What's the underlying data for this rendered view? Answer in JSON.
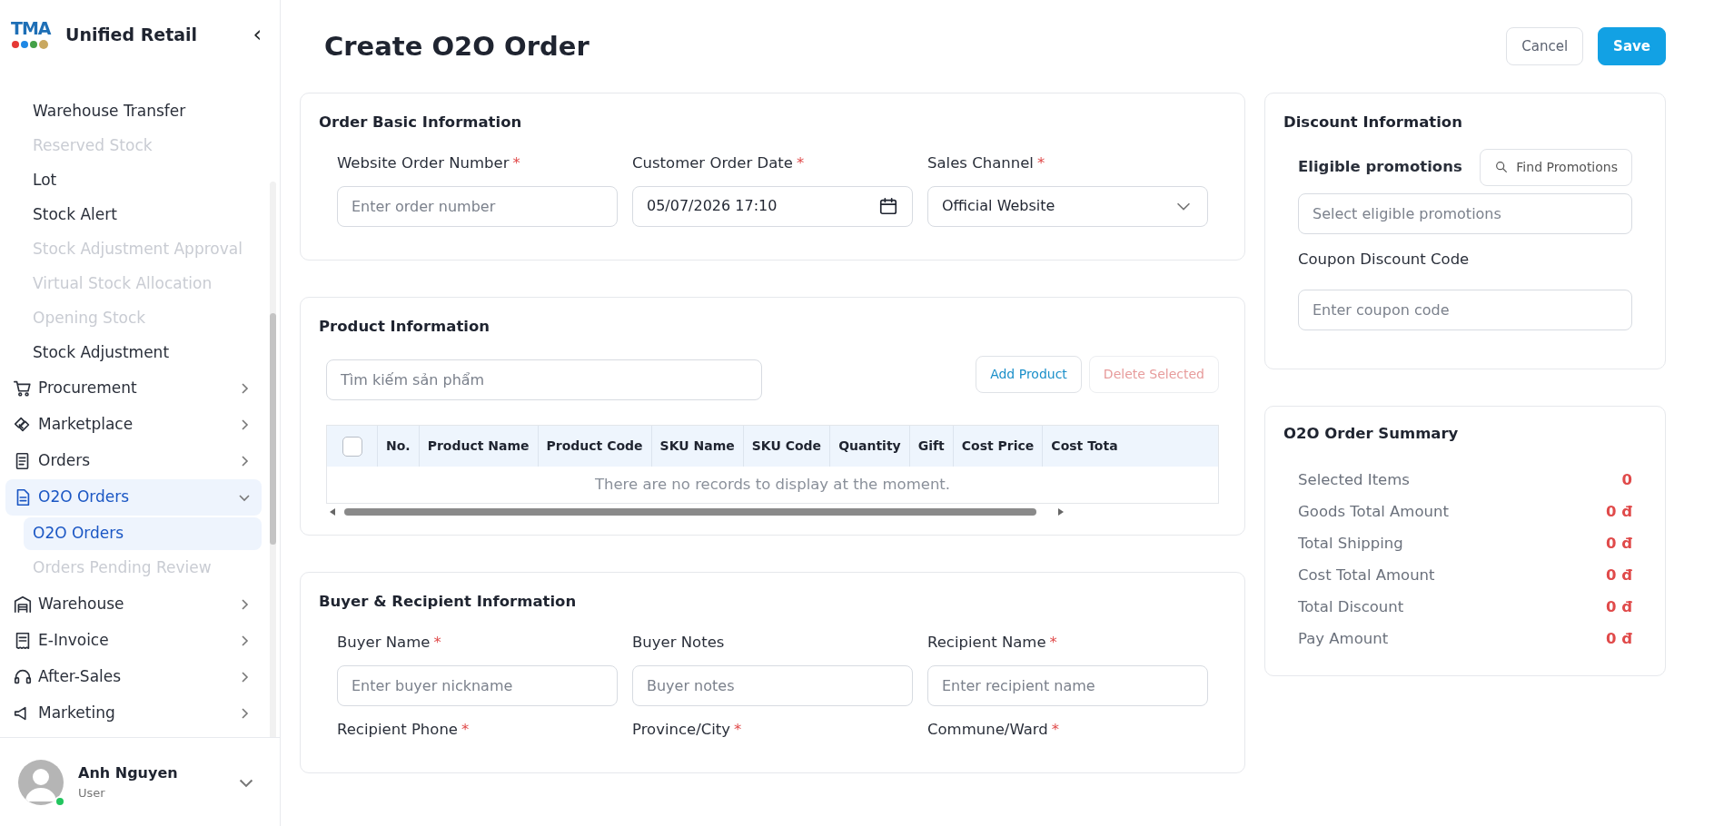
{
  "brand": {
    "logo": "TMA",
    "title": "Unified Retail",
    "collapse": "‹"
  },
  "sidebar": {
    "items": [
      {
        "kind": "sub",
        "label": "Warehouse Transfer",
        "disabled": false,
        "selected": false
      },
      {
        "kind": "sub",
        "label": "Reserved Stock",
        "disabled": true,
        "selected": false
      },
      {
        "kind": "sub",
        "label": "Lot",
        "disabled": false,
        "selected": false
      },
      {
        "kind": "sub",
        "label": "Stock Alert",
        "disabled": false,
        "selected": false
      },
      {
        "kind": "sub",
        "label": "Stock Adjustment Approval",
        "disabled": true,
        "selected": false
      },
      {
        "kind": "sub",
        "label": "Virtual Stock Allocation",
        "disabled": true,
        "selected": false
      },
      {
        "kind": "sub",
        "label": "Opening Stock",
        "disabled": true,
        "selected": false
      },
      {
        "kind": "sub",
        "label": "Stock Adjustment",
        "disabled": false,
        "selected": false
      },
      {
        "kind": "group",
        "label": "Procurement",
        "expanded": false,
        "selected": false
      },
      {
        "kind": "group",
        "label": "Marketplace",
        "expanded": false,
        "selected": false
      },
      {
        "kind": "group",
        "label": "Orders",
        "expanded": false,
        "selected": false
      },
      {
        "kind": "group",
        "label": "O2O Orders",
        "expanded": true,
        "selected": true,
        "children": [
          {
            "label": "O2O Orders",
            "disabled": false,
            "selected": true
          },
          {
            "label": "Orders Pending Review",
            "disabled": true,
            "selected": false
          }
        ]
      },
      {
        "kind": "group",
        "label": "Warehouse",
        "expanded": false,
        "selected": false
      },
      {
        "kind": "group",
        "label": "E-Invoice",
        "expanded": false,
        "selected": false
      },
      {
        "kind": "group",
        "label": "After-Sales",
        "expanded": false,
        "selected": false
      },
      {
        "kind": "group",
        "label": "Marketing",
        "expanded": false,
        "selected": false
      }
    ]
  },
  "user": {
    "name": "Anh Nguyen",
    "role": "User",
    "online": true
  },
  "page": {
    "title": "Create O2O Order",
    "buttons": [
      {
        "label": "Cancel",
        "kind": "secondary"
      },
      {
        "label": "Save",
        "kind": "primary"
      }
    ]
  },
  "sections": [
    {
      "title": "Order Basic Information",
      "fields": [
        {
          "label": "Website Order Number",
          "required_mark": "*",
          "kind": "text",
          "placeholder": "Enter order number"
        },
        {
          "label": "Customer Order Date",
          "required_mark": "*",
          "kind": "date",
          "value": "05/07/2026 17:10"
        },
        {
          "label": "Sales Channel",
          "required_mark": "*",
          "kind": "select",
          "value": "Official Website"
        }
      ]
    },
    {
      "title": "Product Information",
      "search": {
        "placeholder": "Tìm kiếm sản phẩm"
      },
      "actions": [
        {
          "label": "Add Product",
          "disabled": false
        },
        {
          "label": "Delete Selected",
          "disabled": true
        }
      ],
      "table": {
        "select_all": {
          "checked": false
        },
        "columns": [
          "No.",
          "Product Name",
          "Product Code",
          "SKU Name",
          "SKU Code",
          "Quantity",
          "Gift",
          "Cost Price",
          "Cost Tota"
        ],
        "empty_text": "There are no records to display at the moment."
      }
    },
    {
      "title": "Buyer & Recipient Information",
      "fields": [
        {
          "label": "Buyer Name",
          "required_mark": "*",
          "kind": "text",
          "placeholder": "Enter buyer nickname"
        },
        {
          "label": "Buyer Notes",
          "kind": "text",
          "placeholder": "Buyer notes"
        },
        {
          "label": "Recipient Name",
          "required_mark": "*",
          "kind": "text",
          "placeholder": "Enter recipient name"
        },
        {
          "label": "Recipient Phone",
          "required_mark": "*",
          "kind": "label"
        },
        {
          "label": "Province/City",
          "required_mark": "*",
          "kind": "label"
        },
        {
          "label": "Commune/Ward",
          "required_mark": "*",
          "kind": "label"
        }
      ]
    }
  ],
  "discount": {
    "title": "Discount Information",
    "promotions_label": "Eligible promotions",
    "find_button": "Find Promotions",
    "promotions_placeholder": "Select eligible promotions",
    "coupon_label": "Coupon Discount Code",
    "coupon_placeholder": "Enter coupon code"
  },
  "summary": {
    "title": "O2O Order Summary",
    "rows": [
      {
        "label": "Selected Items",
        "value": "0"
      },
      {
        "label": "Goods Total Amount",
        "value": "0 đ"
      },
      {
        "label": "Total Shipping",
        "value": "0 đ"
      },
      {
        "label": "Cost Total Amount",
        "value": "0 đ"
      },
      {
        "label": "Total Discount",
        "value": "0 đ"
      },
      {
        "label": "Pay Amount",
        "value": "0 đ"
      }
    ]
  }
}
